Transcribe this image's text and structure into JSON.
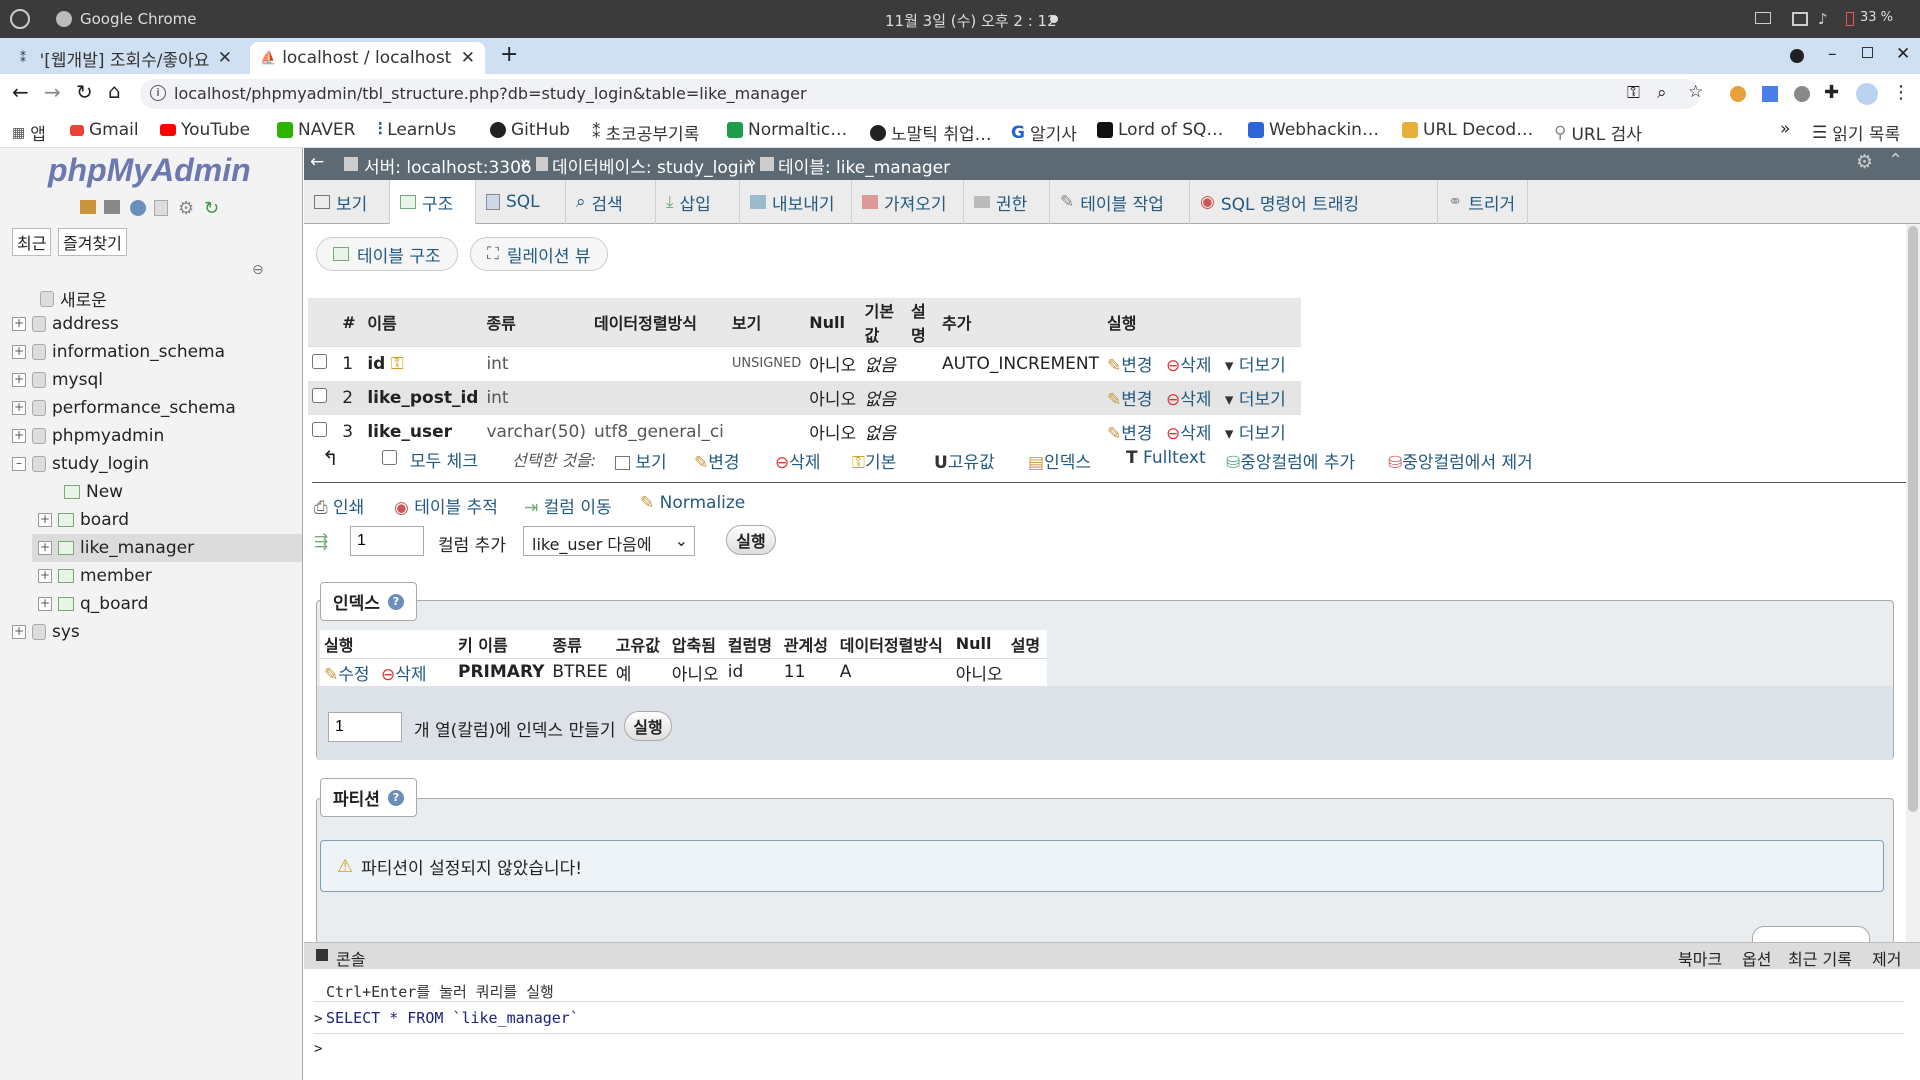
{
  "os": {
    "app": "Google Chrome",
    "clock": "11월 3일 (수) 오후 2 : 12",
    "battery": "33 %"
  },
  "browser": {
    "tabs": [
      {
        "title": "'[웹개발] 조회수/좋아요"
      },
      {
        "title": "localhost / localhost"
      }
    ],
    "url": "localhost/phpmyadmin/tbl_structure.php?db=study_login&table=like_manager",
    "bookmarks": [
      "앱",
      "Gmail",
      "YouTube",
      "NAVER",
      "LearnUs",
      "GitHub",
      "초코공부기록",
      "Normaltic…",
      "노말틱 취업…",
      "알기사",
      "Lord of SQ…",
      "Webhackin…",
      "URL Decod…",
      "URL 검사"
    ],
    "reading_list": "읽기 목록"
  },
  "sidebar": {
    "logo": "phpMyAdmin",
    "recent": "최근",
    "favorites": "즐겨찾기",
    "new": "새로운",
    "dbs": [
      "address",
      "information_schema",
      "mysql",
      "performance_schema",
      "phpmyadmin",
      "study_login"
    ],
    "study_login_items": [
      "New",
      "board",
      "like_manager",
      "member",
      "q_board"
    ],
    "last_db": "sys"
  },
  "breadcrumb": {
    "server": "서버: localhost:3306",
    "database": "데이터베이스: study_login",
    "table": "테이블: like_manager"
  },
  "menu": [
    "보기",
    "구조",
    "SQL",
    "검색",
    "삽입",
    "내보내기",
    "가져오기",
    "권한",
    "테이블 작업",
    "SQL 명령어 트래킹",
    "트리거"
  ],
  "subtabs": [
    "테이블 구조",
    "릴레이션 뷰"
  ],
  "structure": {
    "headers": [
      "#",
      "이름",
      "종류",
      "데이터정렬방식",
      "보기",
      "Null",
      "기본값",
      "설명",
      "추가",
      "실행"
    ],
    "rows": [
      {
        "num": "1",
        "name": "id",
        "type": "int",
        "collation": "",
        "attr": "UNSIGNED",
        "null": "아니오",
        "default": "없음",
        "extra": "AUTO_INCREMENT"
      },
      {
        "num": "2",
        "name": "like_post_id",
        "type": "int",
        "collation": "",
        "attr": "",
        "null": "아니오",
        "default": "없음",
        "extra": ""
      },
      {
        "num": "3",
        "name": "like_user",
        "type": "varchar(50)",
        "collation": "utf8_general_ci",
        "attr": "",
        "null": "아니오",
        "default": "없음",
        "extra": ""
      }
    ],
    "actions": {
      "change": "변경",
      "drop": "삭제",
      "more": "더보기"
    }
  },
  "bulk": {
    "check_all": "모두 체크",
    "with_selected": "선택한 것을:",
    "items": [
      "보기",
      "변경",
      "삭제",
      "기본",
      "고유값",
      "인덱스",
      "Fulltext",
      "중앙컬럼에 추가",
      "중앙컬럼에서 제거"
    ]
  },
  "links": {
    "print": "인쇄",
    "track": "테이블 추적",
    "move": "컬럼 이동",
    "normalize": "Normalize"
  },
  "add_column": {
    "count": "1",
    "label": "컬럼 추가",
    "position": "like_user 다음에",
    "go": "실행"
  },
  "indexes": {
    "legend": "인덱스",
    "headers": [
      "실행",
      "키 이름",
      "종류",
      "고유값",
      "압축됨",
      "컬럼명",
      "관계성",
      "데이터정렬방식",
      "Null",
      "설명"
    ],
    "row": {
      "edit": "수정",
      "drop": "삭제",
      "key": "PRIMARY",
      "type": "BTREE",
      "unique": "예",
      "packed": "아니오",
      "column": "id",
      "cardinality": "11",
      "collation": "A",
      "null": "아니오"
    },
    "create_count": "1",
    "create_label": "개 열(칼럼)에 인덱스 만들기",
    "go": "실행"
  },
  "partitions": {
    "legend": "파티션",
    "notice": "파티션이 설정되지 않았습니다!"
  },
  "console": {
    "title": "콘솔",
    "links": [
      "북마크",
      "옵션",
      "최근 기록",
      "제거"
    ],
    "hint": "Ctrl+Enter를 눌러 쿼리를 실행",
    "query": "SELECT * FROM `like_manager`",
    "prompt": ">"
  }
}
